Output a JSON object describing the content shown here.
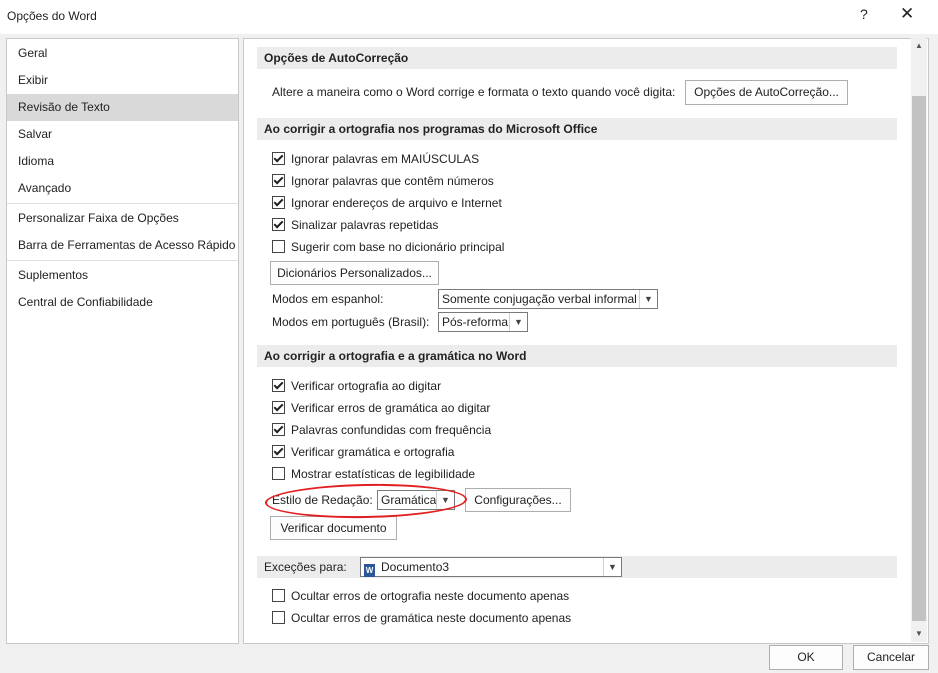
{
  "window": {
    "title": "Opções do Word",
    "help": "?",
    "close": "✕"
  },
  "sidebar": {
    "items": [
      "Geral",
      "Exibir",
      "Revisão de Texto",
      "Salvar",
      "Idioma",
      "Avançado",
      "Personalizar Faixa de Opções",
      "Barra de Ferramentas de Acesso Rápido",
      "Suplementos",
      "Central de Confiabilidade"
    ],
    "active": "Revisão de Texto"
  },
  "autocorrect": {
    "header": "Opções de AutoCorreção",
    "description": "Altere a maneira como o Word corrige e formata o texto quando você digita:",
    "button": "Opções de AutoCorreção..."
  },
  "office_spelling": {
    "header": "Ao corrigir a ortografia nos programas do Microsoft Office",
    "options": [
      {
        "label": "Ignorar palavras em MAIÚSCULAS",
        "checked": true
      },
      {
        "label": "Ignorar palavras que contêm números",
        "checked": true
      },
      {
        "label": "Ignorar endereços de arquivo e Internet",
        "checked": true
      },
      {
        "label": "Sinalizar palavras repetidas",
        "checked": true
      },
      {
        "label": "Sugerir com base no dicionário principal",
        "checked": false
      }
    ],
    "dict_button": "Dicionários Personalizados...",
    "spanish_label": "Modos em espanhol:",
    "spanish_value": "Somente conjugação verbal informal",
    "portuguese_label": "Modos em português (Brasil):",
    "portuguese_value": "Pós-reforma"
  },
  "word_grammar": {
    "header": "Ao corrigir a ortografia e a gramática no Word",
    "options": [
      {
        "label": "Verificar ortografia ao digitar",
        "checked": true
      },
      {
        "label": "Verificar erros de gramática ao digitar",
        "checked": true
      },
      {
        "label": "Palavras confundidas com frequência",
        "checked": true
      },
      {
        "label": "Verificar gramática e ortografia",
        "checked": true
      },
      {
        "label": "Mostrar estatísticas de legibilidade",
        "checked": false
      }
    ],
    "style_label": "Estilo de Redação:",
    "style_value": "Gramática",
    "settings_button": "Configurações...",
    "check_button": "Verificar documento"
  },
  "exceptions": {
    "label": "Exceções para:",
    "document": "Documento3",
    "doc_icon": "W",
    "options": [
      {
        "label": "Ocultar erros de ortografia neste documento apenas",
        "checked": false
      },
      {
        "label": "Ocultar erros de gramática neste documento apenas",
        "checked": false
      }
    ]
  },
  "footer": {
    "ok": "OK",
    "cancel": "Cancelar"
  },
  "annotation_color": "#e02020"
}
